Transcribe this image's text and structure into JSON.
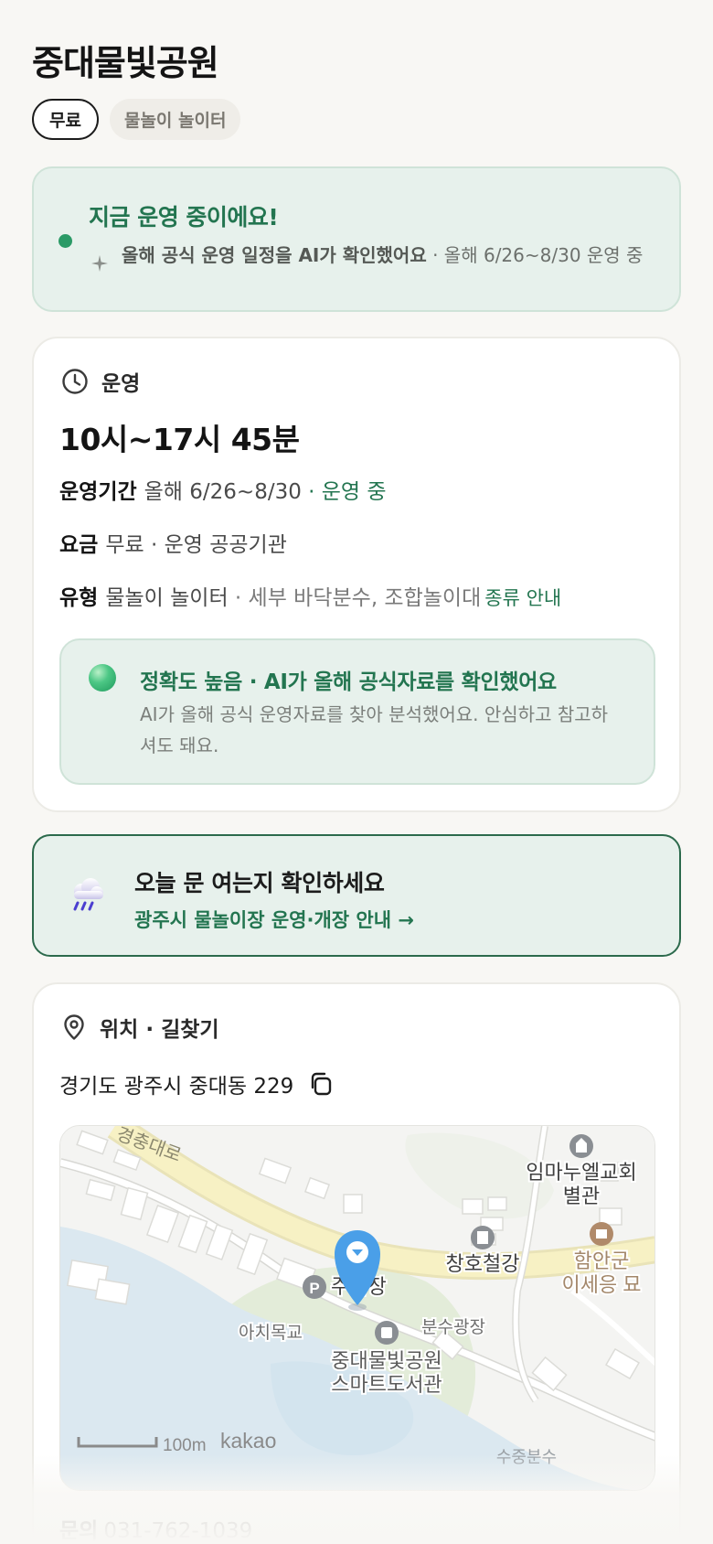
{
  "title": "중대물빛공원",
  "tags": {
    "fee": "무료",
    "type": "물놀이 놀이터"
  },
  "status": {
    "title": "지금 운영 중이에요!",
    "desc_bold": "올해 공식 운영 일정을 AI가 확인했어요",
    "desc_rest": " · 올해 6/26~8/30 운영 중"
  },
  "operation": {
    "section_label": "운영",
    "hours": "10시~17시 45분",
    "period": {
      "label": "운영기간",
      "value": "올해 6/26~8/30",
      "status": " · 운영 중"
    },
    "fee": {
      "label": "요금",
      "value": "무료 · 운영 공공기관"
    },
    "type": {
      "label": "유형",
      "value": "물놀이 놀이터",
      "detail": " · 세부 바닥분수, 조합놀이대",
      "link": "종류 안내"
    },
    "accuracy": {
      "title": "정확도 높음 · AI가 올해 공식자료를 확인했어요",
      "desc": "AI가 올해 공식 운영자료를 찾아 분석했어요. 안심하고 참고하셔도 돼요."
    }
  },
  "notice": {
    "title": "오늘 문 여는지 확인하세요",
    "link": "광주시 물놀이장 운영·개장 안내 →"
  },
  "location": {
    "section_label": "위치 · 길찾기",
    "address": "경기도 광주시 중대동 229",
    "map": {
      "road_label": "경충대로",
      "labels": {
        "church": "임마누엘교회",
        "church2": "별관",
        "hardware": "창호철강",
        "tomb": "함안군",
        "tomb2": "이세응 묘",
        "parking": "주차장",
        "bridge": "아치목교",
        "plaza": "분수광장",
        "library": "중대물빛공원",
        "library2": "스마트도서관",
        "fountain": "수중분수"
      },
      "scale": "100m",
      "brand": "kakao"
    },
    "contact": {
      "label": "문의",
      "value": "031-762-1039"
    }
  },
  "colors": {
    "accent": "#237550",
    "card_green": "#e7f1ec",
    "pin": "#4a9fe8"
  }
}
